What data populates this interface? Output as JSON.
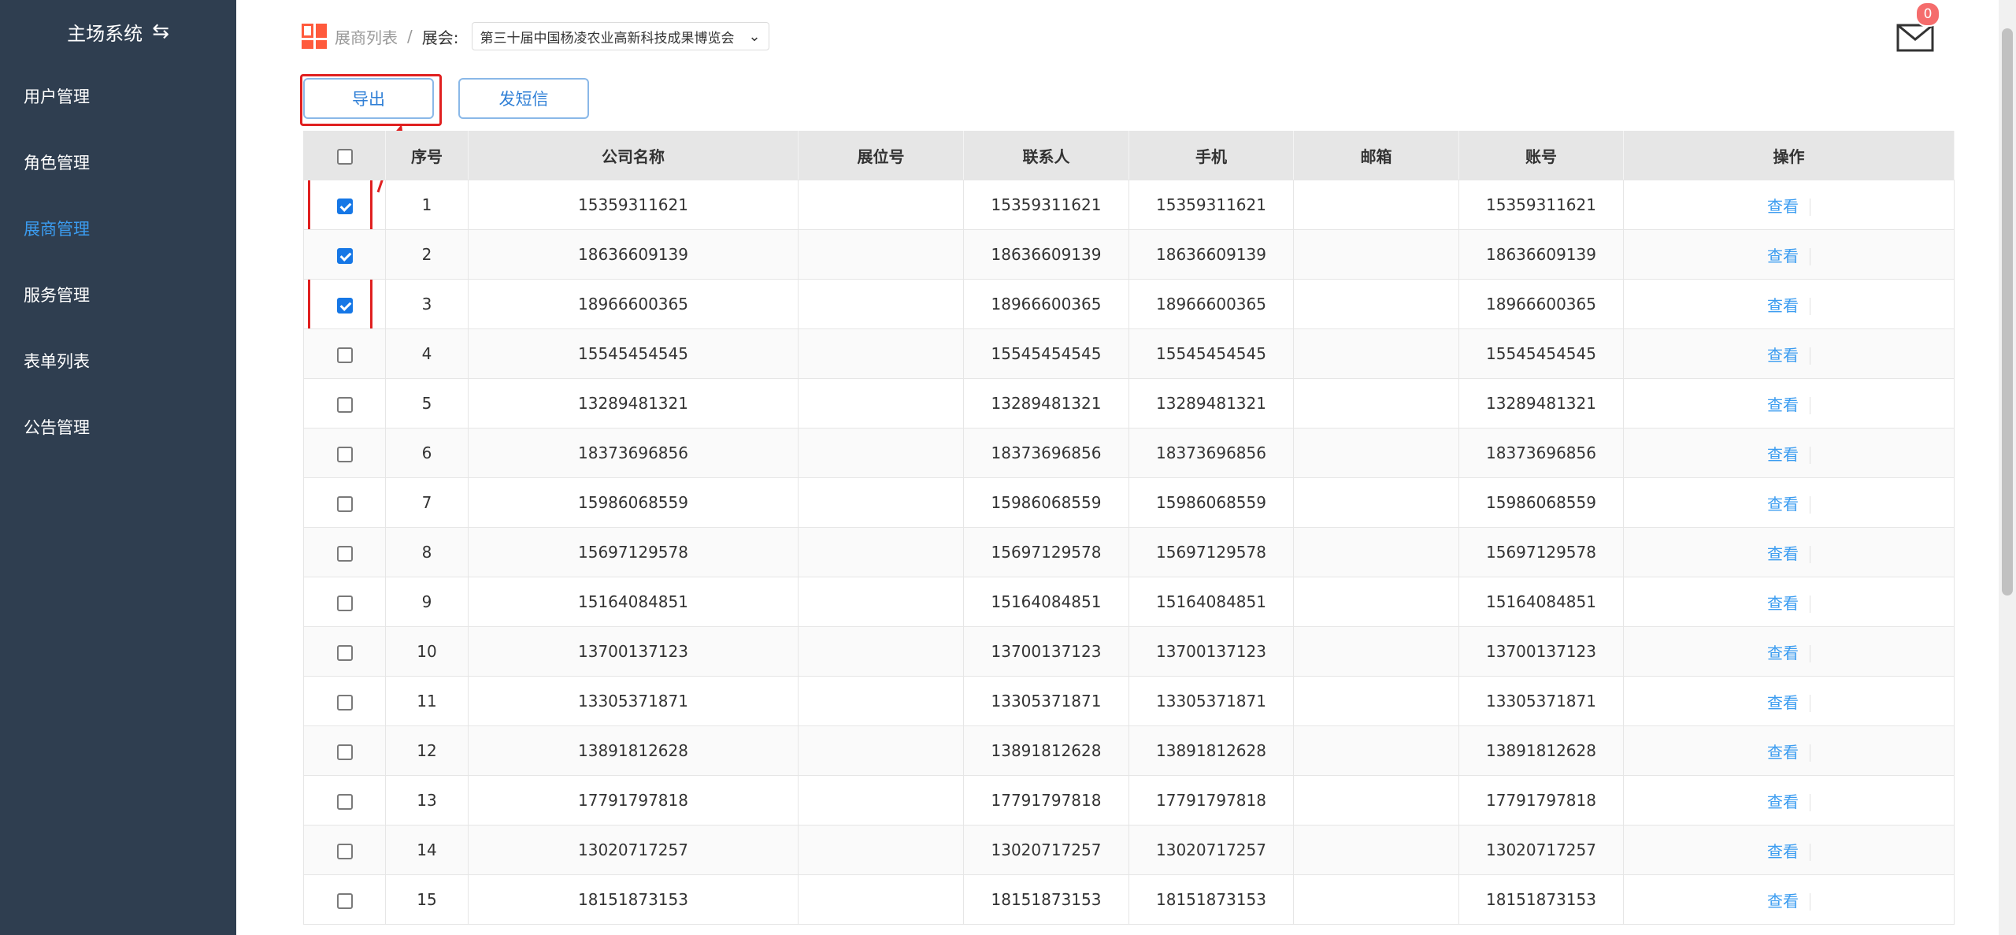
{
  "sidebar": {
    "title": "主场系统",
    "switch_icon": "swap-icon",
    "items": [
      {
        "label": "用户管理",
        "active": false
      },
      {
        "label": "角色管理",
        "active": false
      },
      {
        "label": "展商管理",
        "active": true
      },
      {
        "label": "服务管理",
        "active": false
      },
      {
        "label": "表单列表",
        "active": false
      },
      {
        "label": "公告管理",
        "active": false
      }
    ],
    "active_color": "#3b9cf0",
    "bg_color": "#2f3e50"
  },
  "breadcrumb": {
    "parent": "展商列表",
    "separator": "/",
    "current_label": "展会:",
    "select_value": "第三十届中国杨凌农业高新科技成果博览会"
  },
  "mail": {
    "badge_count": "0"
  },
  "toolbar": {
    "export_label": "导出",
    "sms_label": "发短信"
  },
  "table": {
    "columns": [
      "序号",
      "公司名称",
      "展位号",
      "联系人",
      "手机",
      "邮箱",
      "账号",
      "操作"
    ],
    "action_label": "查看",
    "rows": [
      {
        "checked": true,
        "index": "1",
        "company": "15359311621",
        "booth": "",
        "contact": "15359311621",
        "phone": "15359311621",
        "email": "",
        "account": "15359311621"
      },
      {
        "checked": true,
        "index": "2",
        "company": "18636609139",
        "booth": "",
        "contact": "18636609139",
        "phone": "18636609139",
        "email": "",
        "account": "18636609139"
      },
      {
        "checked": true,
        "index": "3",
        "company": "18966600365",
        "booth": "",
        "contact": "18966600365",
        "phone": "18966600365",
        "email": "",
        "account": "18966600365"
      },
      {
        "checked": false,
        "index": "4",
        "company": "15545454545",
        "booth": "",
        "contact": "15545454545",
        "phone": "15545454545",
        "email": "",
        "account": "15545454545"
      },
      {
        "checked": false,
        "index": "5",
        "company": "13289481321",
        "booth": "",
        "contact": "13289481321",
        "phone": "13289481321",
        "email": "",
        "account": "13289481321"
      },
      {
        "checked": false,
        "index": "6",
        "company": "18373696856",
        "booth": "",
        "contact": "18373696856",
        "phone": "18373696856",
        "email": "",
        "account": "18373696856"
      },
      {
        "checked": false,
        "index": "7",
        "company": "15986068559",
        "booth": "",
        "contact": "15986068559",
        "phone": "15986068559",
        "email": "",
        "account": "15986068559"
      },
      {
        "checked": false,
        "index": "8",
        "company": "15697129578",
        "booth": "",
        "contact": "15697129578",
        "phone": "15697129578",
        "email": "",
        "account": "15697129578"
      },
      {
        "checked": false,
        "index": "9",
        "company": "15164084851",
        "booth": "",
        "contact": "15164084851",
        "phone": "15164084851",
        "email": "",
        "account": "15164084851"
      },
      {
        "checked": false,
        "index": "10",
        "company": "13700137123",
        "booth": "",
        "contact": "13700137123",
        "phone": "13700137123",
        "email": "",
        "account": "13700137123"
      },
      {
        "checked": false,
        "index": "11",
        "company": "13305371871",
        "booth": "",
        "contact": "13305371871",
        "phone": "13305371871",
        "email": "",
        "account": "13305371871"
      },
      {
        "checked": false,
        "index": "12",
        "company": "13891812628",
        "booth": "",
        "contact": "13891812628",
        "phone": "13891812628",
        "email": "",
        "account": "13891812628"
      },
      {
        "checked": false,
        "index": "13",
        "company": "17791797818",
        "booth": "",
        "contact": "17791797818",
        "phone": "17791797818",
        "email": "",
        "account": "17791797818"
      },
      {
        "checked": false,
        "index": "14",
        "company": "13020717257",
        "booth": "",
        "contact": "13020717257",
        "phone": "13020717257",
        "email": "",
        "account": "13020717257"
      },
      {
        "checked": false,
        "index": "15",
        "company": "18151873153",
        "booth": "",
        "contact": "18151873153",
        "phone": "18151873153",
        "email": "",
        "account": "18151873153"
      }
    ]
  }
}
